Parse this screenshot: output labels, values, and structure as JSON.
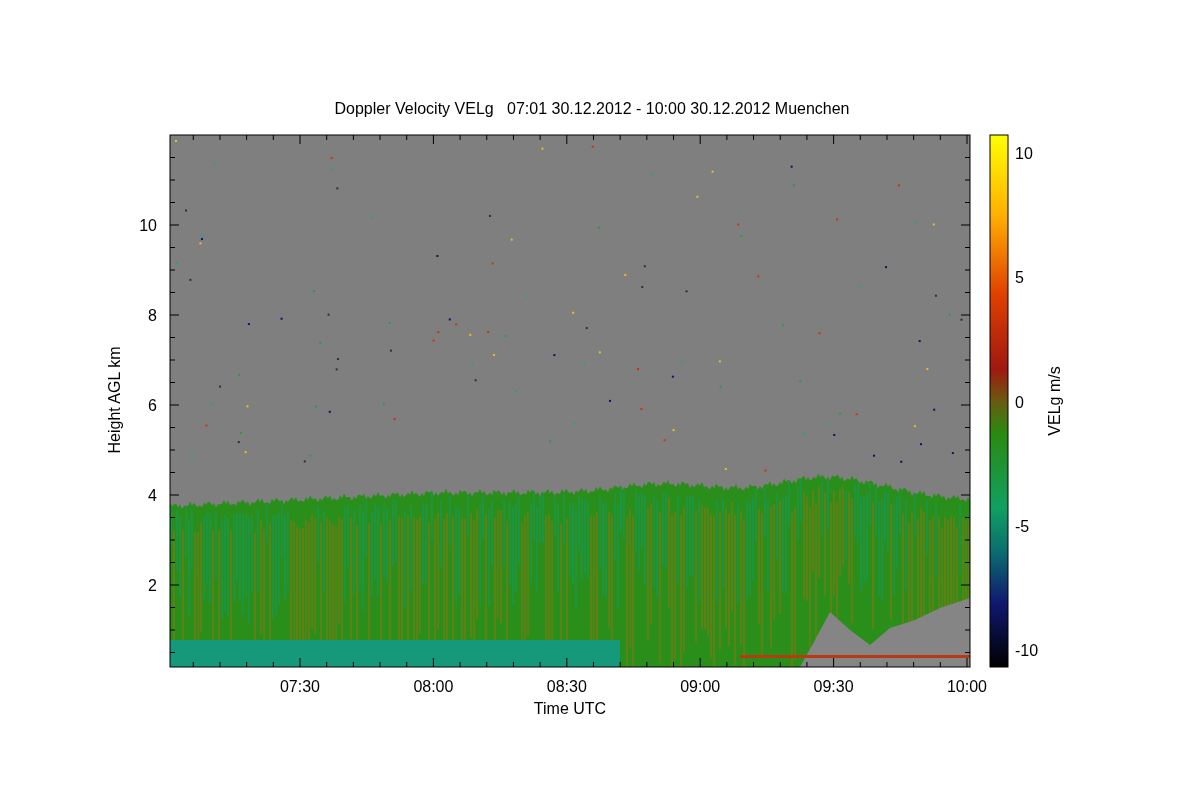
{
  "title": "Doppler Velocity VELg   07:01 30.12.2012 - 10:00 30.12.2012 Muenchen",
  "y_axis": {
    "label": "Height AGL km",
    "ticks": [
      "10",
      "8",
      "6",
      "4",
      "2"
    ]
  },
  "x_axis": {
    "label": "Time UTC",
    "ticks": [
      "07:30",
      "08:00",
      "08:30",
      "09:00",
      "09:30",
      "10:00"
    ]
  },
  "colorbar": {
    "label": "VELg m/s",
    "ticks": [
      "10",
      "5",
      "0",
      "-5",
      "-10"
    ]
  }
}
